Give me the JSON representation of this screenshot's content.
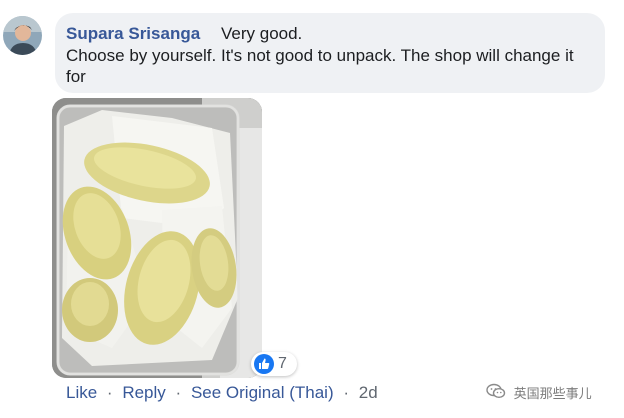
{
  "comment": {
    "author": "Supara Srisanga",
    "first_line": "Very good.",
    "body": "Choose by yourself. It's not good to unpack. The shop will change it for"
  },
  "reactions": {
    "icon": "like-icon",
    "count": "7"
  },
  "actions": {
    "like": "Like",
    "reply": "Reply",
    "see_original": "See Original (Thai)",
    "separator": "·",
    "time": "2d"
  },
  "watermark": {
    "text": "英国那些事儿"
  },
  "colors": {
    "name_link": "#385898",
    "bubble_bg": "#eff1f4",
    "like_badge": "#1877f2"
  }
}
